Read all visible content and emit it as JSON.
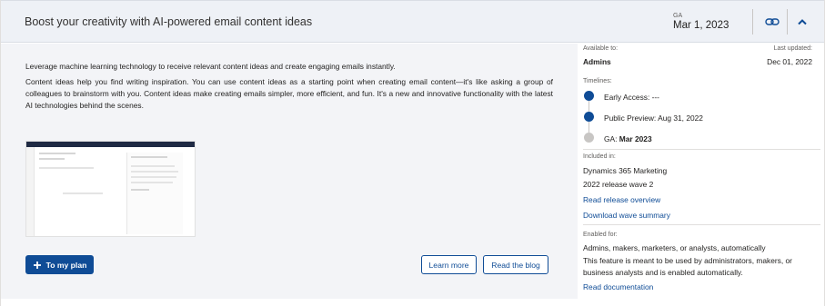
{
  "header": {
    "title": "Boost your creativity with AI-powered email content ideas",
    "ga_label": "GA",
    "ga_date": "Mar 1, 2023",
    "link_icon": "link-icon",
    "collapse_icon": "chevron-up-icon"
  },
  "main": {
    "lead": "Leverage machine learning technology to receive relevant content ideas and create engaging emails instantly.",
    "description": "Content ideas help you find writing inspiration. You can use content ideas as a starting point when creating email content—it's like asking a group of colleagues to brainstorm with you. Content ideas make creating emails simpler, more efficient, and fun. It's a new and innovative functionality with the latest AI technologies behind the scenes.",
    "buttons": {
      "plan": "To my plan",
      "learn_more": "Learn more",
      "read_blog": "Read the blog"
    }
  },
  "sidebar": {
    "available_to_label": "Available to:",
    "available_to_value": "Admins",
    "last_updated_label": "Last updated:",
    "last_updated_value": "Dec 01, 2022",
    "timelines_label": "Timelines:",
    "timeline": [
      {
        "text": "Early Access: ---",
        "status": "complete"
      },
      {
        "text": "Public Preview: Aug 31, 2022",
        "status": "complete"
      },
      {
        "prefix": "GA: ",
        "date": "Mar 2023",
        "status": "upcoming"
      }
    ],
    "included_in_label": "Included in:",
    "included_in_product": "Dynamics 365 Marketing",
    "included_in_wave": "2022 release wave 2",
    "read_release_overview": "Read release overview",
    "download_wave_summary": "Download wave summary",
    "enabled_for_label": "Enabled for:",
    "enabled_for_value": "Admins, makers, marketers, or analysts, automatically",
    "enabled_for_description": "This feature is meant to be used by administrators, makers, or business analysts and is enabled automatically.",
    "read_documentation": "Read documentation"
  },
  "colors": {
    "accent": "#0f4c96",
    "timeline_complete": "#0f4c96",
    "timeline_upcoming": "#c8c6c4",
    "header_bg": "#eef1f6",
    "main_bg": "#f3f4f7"
  }
}
